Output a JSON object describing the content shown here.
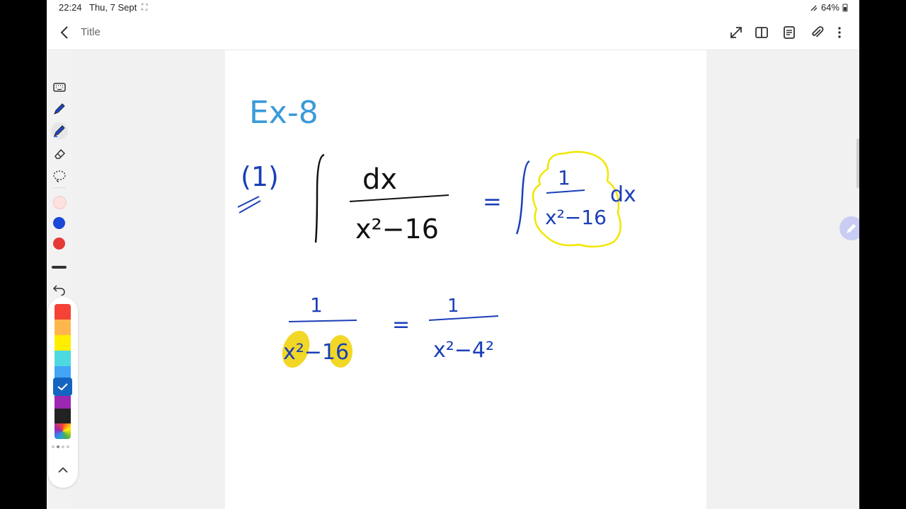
{
  "status_bar": {
    "time": "22:24",
    "date": "Thu, 7 Sept",
    "battery": "64%"
  },
  "toolbar": {
    "title": "Title"
  },
  "colors": {
    "blue_ink": "#1a3fb8",
    "light_blue_ink": "#3a9ad9",
    "yellow_highlight": "#f0d000",
    "yellow_outline": "#f2e600"
  },
  "handwriting": {
    "heading": "Ex-8",
    "problem_number": "(1)",
    "integral_numerator": "dx",
    "integral_denominator": "x²−16",
    "equals": "=",
    "rewrite_numerator": "1",
    "rewrite_denominator": "x²−16",
    "rewrite_dx": "dx",
    "step_numerator": "1",
    "step_denominator": "x²−16",
    "step_equals": "=",
    "result_numerator": "1",
    "result_denominator": "x²−4²"
  },
  "palette_colors": [
    "#f44336",
    "#ffb74d",
    "#ffee00",
    "#4dd9e0",
    "#42a5f5",
    "#1565c0",
    "#9c27b0",
    "#222222"
  ],
  "tool_dots": [
    "#fde0e0",
    "#1a47d6",
    "#e53935"
  ]
}
